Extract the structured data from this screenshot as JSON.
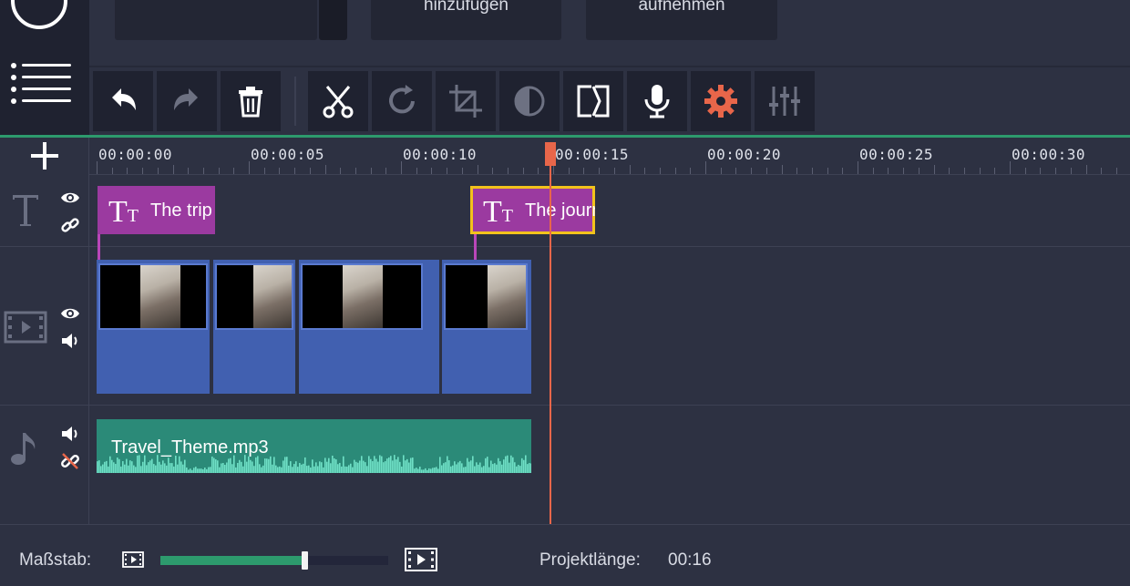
{
  "top": {
    "panels": [
      {
        "label": ""
      },
      {
        "label": "hinzufügen"
      },
      {
        "label": "aufnehmen"
      }
    ]
  },
  "toolbar": {
    "buttons": [
      "undo-icon",
      "redo-icon",
      "trash-icon",
      "scissors-icon",
      "rotate-icon",
      "crop-icon",
      "color-adjust-icon",
      "transition-icon",
      "microphone-icon",
      "settings-icon",
      "equalizer-icon"
    ],
    "accent_color": "#e8664a"
  },
  "timeline": {
    "ruler_labels": [
      "00:00:00",
      "00:00:05",
      "00:00:10",
      "00:00:15",
      "00:00:20",
      "00:00:25",
      "00:00:30"
    ],
    "title_clips": [
      {
        "label": "The trip"
      },
      {
        "label": "The journey"
      }
    ],
    "audio_clip": {
      "label": "Travel_Theme.mp3"
    },
    "colors": {
      "title_clip": "#9b3aa0",
      "video_clip": "#4160b0",
      "audio_clip": "#2b8a78",
      "playhead": "#e8664a",
      "timeline_accent": "#2d9a6d"
    }
  },
  "bottom": {
    "scale_label": "Maßstab:",
    "project_length_label": "Projektlänge:",
    "project_length_value": "00:16",
    "zoom_level": 0.63
  }
}
